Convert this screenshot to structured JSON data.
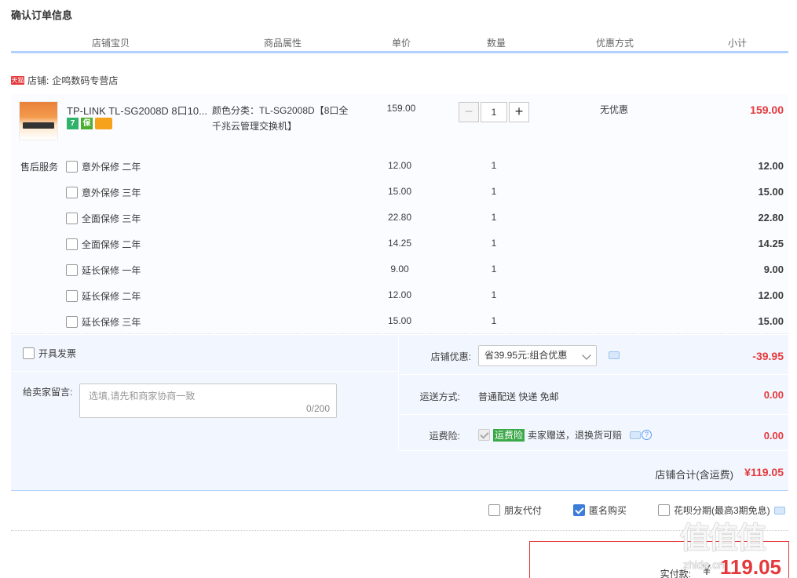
{
  "page_title": "确认订单信息",
  "columns": [
    "店铺宝贝",
    "商品属性",
    "单价",
    "数量",
    "优惠方式",
    "小计"
  ],
  "store": {
    "badge": "天猫",
    "label": "店铺:",
    "name": "企鸣数码专营店"
  },
  "item": {
    "name": "TP-LINK TL-SG2008D 8口10...",
    "badges": [
      "7",
      "保"
    ],
    "attr_line1": "颜色分类：TL-SG2008D【8口全",
    "attr_line2": "千兆云管理交换机】",
    "price": "159.00",
    "quantity": "1",
    "minus": "−",
    "plus": "+",
    "promo": "无优惠",
    "subtotal": "159.00"
  },
  "service_label": "售后服务",
  "services": [
    {
      "name": "意外保修 二年",
      "price": "12.00",
      "qty": "1",
      "subtotal": "12.00"
    },
    {
      "name": "意外保修 三年",
      "price": "15.00",
      "qty": "1",
      "subtotal": "15.00"
    },
    {
      "name": "全面保修 三年",
      "price": "22.80",
      "qty": "1",
      "subtotal": "22.80"
    },
    {
      "name": "全面保修 二年",
      "price": "14.25",
      "qty": "1",
      "subtotal": "14.25"
    },
    {
      "name": "延长保修 一年",
      "price": "9.00",
      "qty": "1",
      "subtotal": "9.00"
    },
    {
      "name": "延长保修 二年",
      "price": "12.00",
      "qty": "1",
      "subtotal": "12.00"
    },
    {
      "name": "延长保修 三年",
      "price": "15.00",
      "qty": "1",
      "subtotal": "15.00"
    }
  ],
  "invoice_label": "开具发票",
  "message": {
    "label": "给卖家留言:",
    "placeholder": "选填,请先和商家协商一致",
    "count": "0/200"
  },
  "store_discount": {
    "label": "店铺优惠:",
    "selected": "省39.95元:组合优惠",
    "amount": "-39.95"
  },
  "shipping": {
    "label": "运送方式:",
    "value": "普通配送 快递 免邮",
    "amount": "0.00"
  },
  "insurance": {
    "label": "运费险:",
    "badge": "运费险",
    "text": "卖家赠送，退换货可赔",
    "amount": "0.00"
  },
  "store_total": {
    "label": "店铺合计(含运费)",
    "value": "¥119.05"
  },
  "options": {
    "friend_pay": "朋友代付",
    "anonymous": "匿名购买",
    "huabei": "花呗分期(最高3期免息)"
  },
  "pay": {
    "label": "实付款:",
    "currency": "¥",
    "value": "119.05"
  },
  "watermark": {
    "main": "值值值",
    "sub": "zhide.cn"
  }
}
